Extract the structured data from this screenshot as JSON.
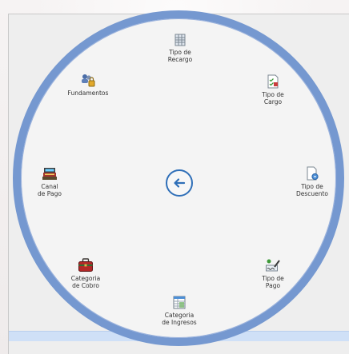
{
  "menu": {
    "items": [
      {
        "id": "recargo",
        "label": "Tipo de\nRecargo",
        "icon": "ledger-grid-icon"
      },
      {
        "id": "cargo",
        "label": "Tipo de\nCargo",
        "icon": "checklist-doc-icon"
      },
      {
        "id": "descuento",
        "label": "Tipo de\nDescuento",
        "icon": "document-badge-icon"
      },
      {
        "id": "pago",
        "label": "Tipo de\nPago",
        "icon": "pen-signature-icon"
      },
      {
        "id": "ingresos",
        "label": "Categoria\nde Ingresos",
        "icon": "spreadsheet-icon"
      },
      {
        "id": "cobro",
        "label": "Categoria\nde Cobro",
        "icon": "briefcase-icon"
      },
      {
        "id": "canal",
        "label": "Canal\nde Pago",
        "icon": "cash-register-icon"
      },
      {
        "id": "fundamentos",
        "label": "Fundamentos",
        "icon": "users-lock-icon"
      }
    ],
    "back_icon": "back-arrow-icon"
  },
  "colors": {
    "ring": "#7598d0",
    "accent": "#2f6fb8",
    "bottom_bar": "#cfe0f7"
  }
}
